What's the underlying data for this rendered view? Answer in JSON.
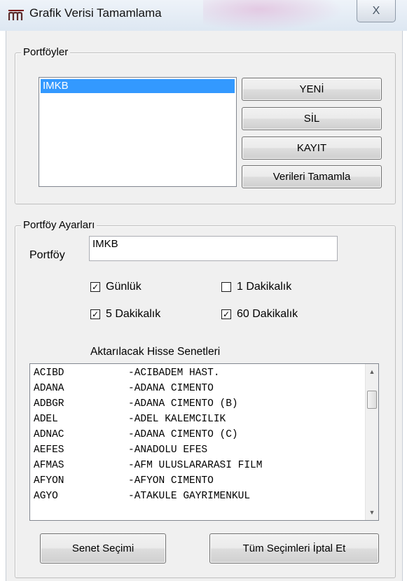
{
  "window": {
    "title": "Grafik Verisi Tamamlama",
    "close_glyph": "X",
    "icon": "chart-app-icon"
  },
  "portfolios": {
    "group_label": "Portföyler",
    "items": [
      "IMKB"
    ],
    "selected": "IMKB",
    "buttons": {
      "new": "YENİ",
      "delete": "SİL",
      "save": "KAYIT",
      "complete": "Verileri Tamamla"
    }
  },
  "settings": {
    "group_label": "Portföy Ayarları",
    "portfolio_label": "Portföy",
    "portfolio_value": "IMKB",
    "checkboxes": [
      {
        "label": "Günlük",
        "checked": true
      },
      {
        "label": "1 Dakikalık",
        "checked": false
      },
      {
        "label": "5 Dakikalık",
        "checked": true
      },
      {
        "label": "60 Dakikalık",
        "checked": true
      }
    ],
    "stocks_label": "Aktarılacak Hisse Senetleri",
    "stocks": [
      {
        "code": "ACIBD",
        "name": "-ACIBADEM HAST."
      },
      {
        "code": "ADANA",
        "name": "-ADANA CIMENTO"
      },
      {
        "code": "ADBGR",
        "name": "-ADANA CIMENTO (B)"
      },
      {
        "code": "ADEL",
        "name": "-ADEL KALEMCILIK"
      },
      {
        "code": "ADNAC",
        "name": "-ADANA CIMENTO (C)"
      },
      {
        "code": "AEFES",
        "name": "-ANADOLU EFES"
      },
      {
        "code": "AFMAS",
        "name": "-AFM ULUSLARARASI FILM"
      },
      {
        "code": "AFYON",
        "name": "-AFYON CIMENTO"
      },
      {
        "code": "AGYO",
        "name": "-ATAKULE GAYRIMENKUL"
      }
    ],
    "buttons": {
      "select": "Senet Seçimi",
      "cancel_all": "Tüm Seçimleri İptal Et"
    }
  },
  "colors": {
    "selection": "#3399ff",
    "window_bg": "#f0f0f0"
  }
}
